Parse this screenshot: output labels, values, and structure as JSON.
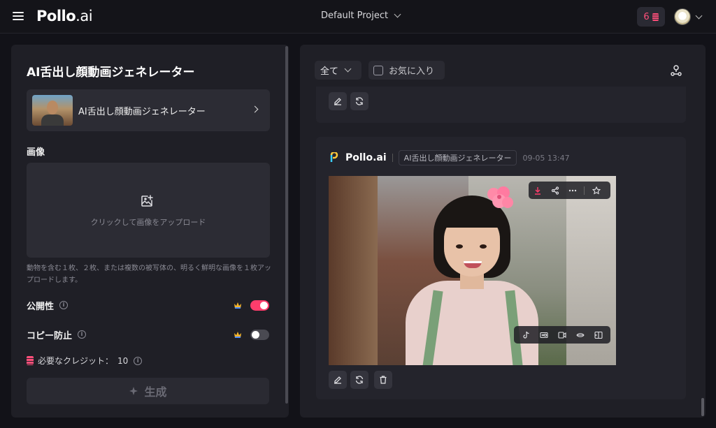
{
  "header": {
    "logo_main": "Pollo",
    "logo_suffix": ".ai",
    "project": "Default Project",
    "credits": "6"
  },
  "left": {
    "title": "AI舌出し顔動画ジェネレーター",
    "model_label": "AI舌出し顔動画ジェネレーター",
    "image_section": "画像",
    "upload_text": "クリックして画像をアップロード",
    "hint": "動物を含む１枚、２枚、または複数の被写体の、明るく鮮明な画像を１枚アップロードします。",
    "public_label": "公開性",
    "public_on": true,
    "copy_label": "コピー防止",
    "copy_on": false,
    "credit_label": "必要なクレジット：",
    "credit_value": "10",
    "generate": "生成"
  },
  "right": {
    "filter": "全て",
    "favorites": "お気に入り",
    "brand": "Pollo.ai",
    "tag": "AI舌出し顔動画ジェネレーター",
    "time": "09-05 13:47"
  },
  "colors": {
    "accent": "#ff3d6c",
    "panel": "#1f1f26",
    "card": "#24242c"
  }
}
